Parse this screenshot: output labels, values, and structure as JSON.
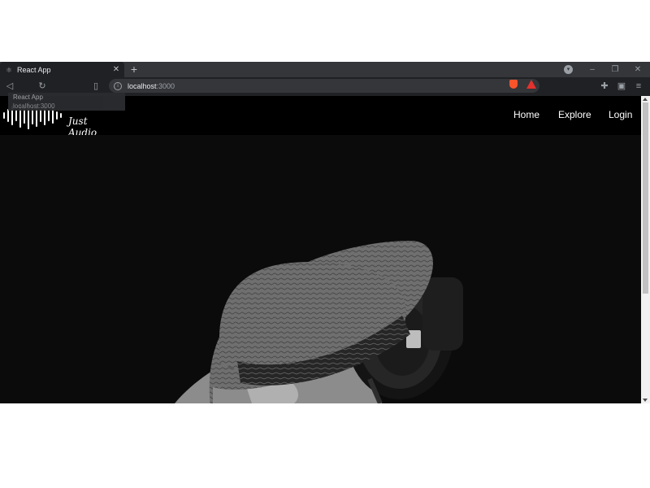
{
  "browser": {
    "tab": {
      "title": "React App",
      "favicon": "react-icon",
      "close": "✕"
    },
    "new_tab": "+",
    "window_controls": {
      "minimize": "–",
      "maximize": "❐",
      "close": "✕"
    },
    "address": {
      "host": "localhost",
      "port": ":3000"
    },
    "tooltip": {
      "title": "React App",
      "url": "localhost:3000"
    }
  },
  "site": {
    "logo_text": "Just Audio",
    "nav": [
      {
        "label": "Home"
      },
      {
        "label": "Explore"
      },
      {
        "label": "Login"
      }
    ]
  },
  "colors": {
    "nav_bg": "#000000",
    "hero_bg": "#0b0b0b",
    "chrome": "#202124"
  }
}
